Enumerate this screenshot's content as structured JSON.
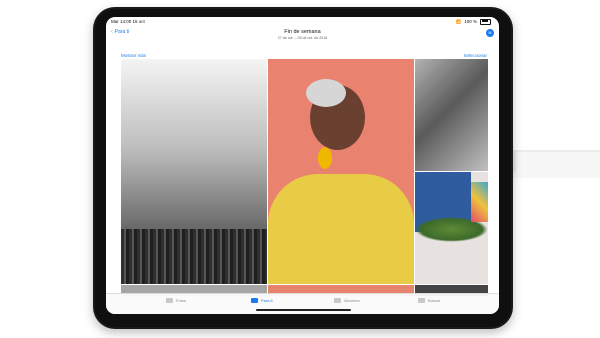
{
  "status_bar": {
    "time": "Mar 14:00 15 oct",
    "battery": "100 %"
  },
  "nav": {
    "back_label": "Para ti",
    "title": "Fin de semana",
    "subtitle": "27 de oct. – 28 de oct. de 2018",
    "avatar": "M"
  },
  "subheader": {
    "left": "Mostrar más",
    "right": "Seleccionar"
  },
  "tabs": [
    {
      "label": "Fotos",
      "icon": "photos-icon"
    },
    {
      "label": "Para ti",
      "icon": "for-you-icon"
    },
    {
      "label": "Álbumes",
      "icon": "albums-icon"
    },
    {
      "label": "Buscar",
      "icon": "search-icon"
    }
  ],
  "colors": {
    "accent": "#1a7bf0"
  }
}
